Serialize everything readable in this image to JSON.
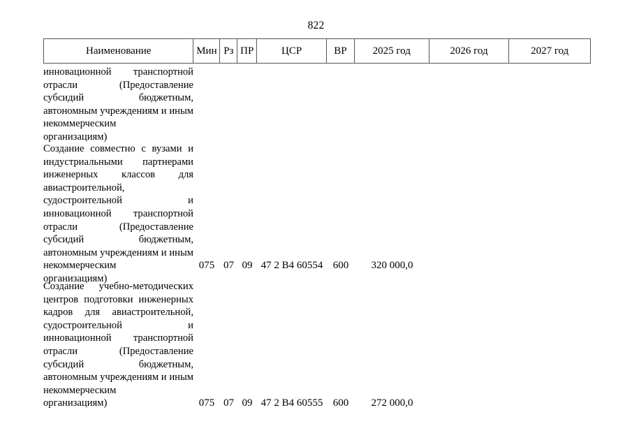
{
  "document": {
    "page_number": "822",
    "language": "ru"
  },
  "table": {
    "columns": [
      {
        "key": "name",
        "label": "Наименование"
      },
      {
        "key": "min",
        "label": "Мин"
      },
      {
        "key": "rz",
        "label": "Рз"
      },
      {
        "key": "pr",
        "label": "ПР"
      },
      {
        "key": "csr",
        "label": "ЦСР"
      },
      {
        "key": "vr",
        "label": "ВР"
      },
      {
        "key": "y2025",
        "label": "2025 год"
      },
      {
        "key": "y2026",
        "label": "2026 год"
      },
      {
        "key": "y2027",
        "label": "2027 год"
      }
    ],
    "rows": [
      {
        "name_lines": [
          "инновационной транспортной отрасли (Предоставление субсидий бюджетным, автономным учреждениям и иным некоммерческим",
          "организациям)"
        ],
        "name": "инновационной транспортной отрасли (Предоставление субсидий бюджетным, автономным учреждениям и иным некоммерческим организациям)",
        "min": "",
        "rz": "",
        "pr": "",
        "csr": "",
        "vr": "",
        "y2025": "",
        "y2026": "",
        "y2027": ""
      },
      {
        "name_lines": [
          "Создание совместно с вузами и индустриальными партнерами инженерных классов для авиастроительной, судостроительной и инновационной транспортной отрасли (Предоставление субсидий бюджетным, автономным учреждениям и иным некоммерческим",
          "организациям)"
        ],
        "name": "Создание совместно с вузами и индустриальными партнерами инженерных классов для авиастроительной, судостроительной и инновационной транспортной отрасли (Предоставление субсидий бюджетным, автономным учреждениям и иным некоммерческим организациям)",
        "min": "075",
        "rz": "07",
        "pr": "09",
        "csr": "47 2 В4 60554",
        "vr": "600",
        "y2025": "320 000,0",
        "y2026": "",
        "y2027": ""
      },
      {
        "name_lines": [
          "Создание учебно-методических центров подготовки инженерных кадров для авиастроительной, судостроительной и инновационной транспортной отрасли (Предоставление субсидий бюджетным, автономным учреждениям и иным некоммерческим",
          "организациям)"
        ],
        "name": "Создание учебно-методических центров подготовки инженерных кадров для авиастроительной, судостроительной и инновационной транспортной отрасли (Предоставление субсидий бюджетным, автономным учреждениям и иным некоммерческим организациям)",
        "min": "075",
        "rz": "07",
        "pr": "09",
        "csr": "47 2 В4 60555",
        "vr": "600",
        "y2025": "272 000,0",
        "y2026": "",
        "y2027": ""
      }
    ]
  }
}
